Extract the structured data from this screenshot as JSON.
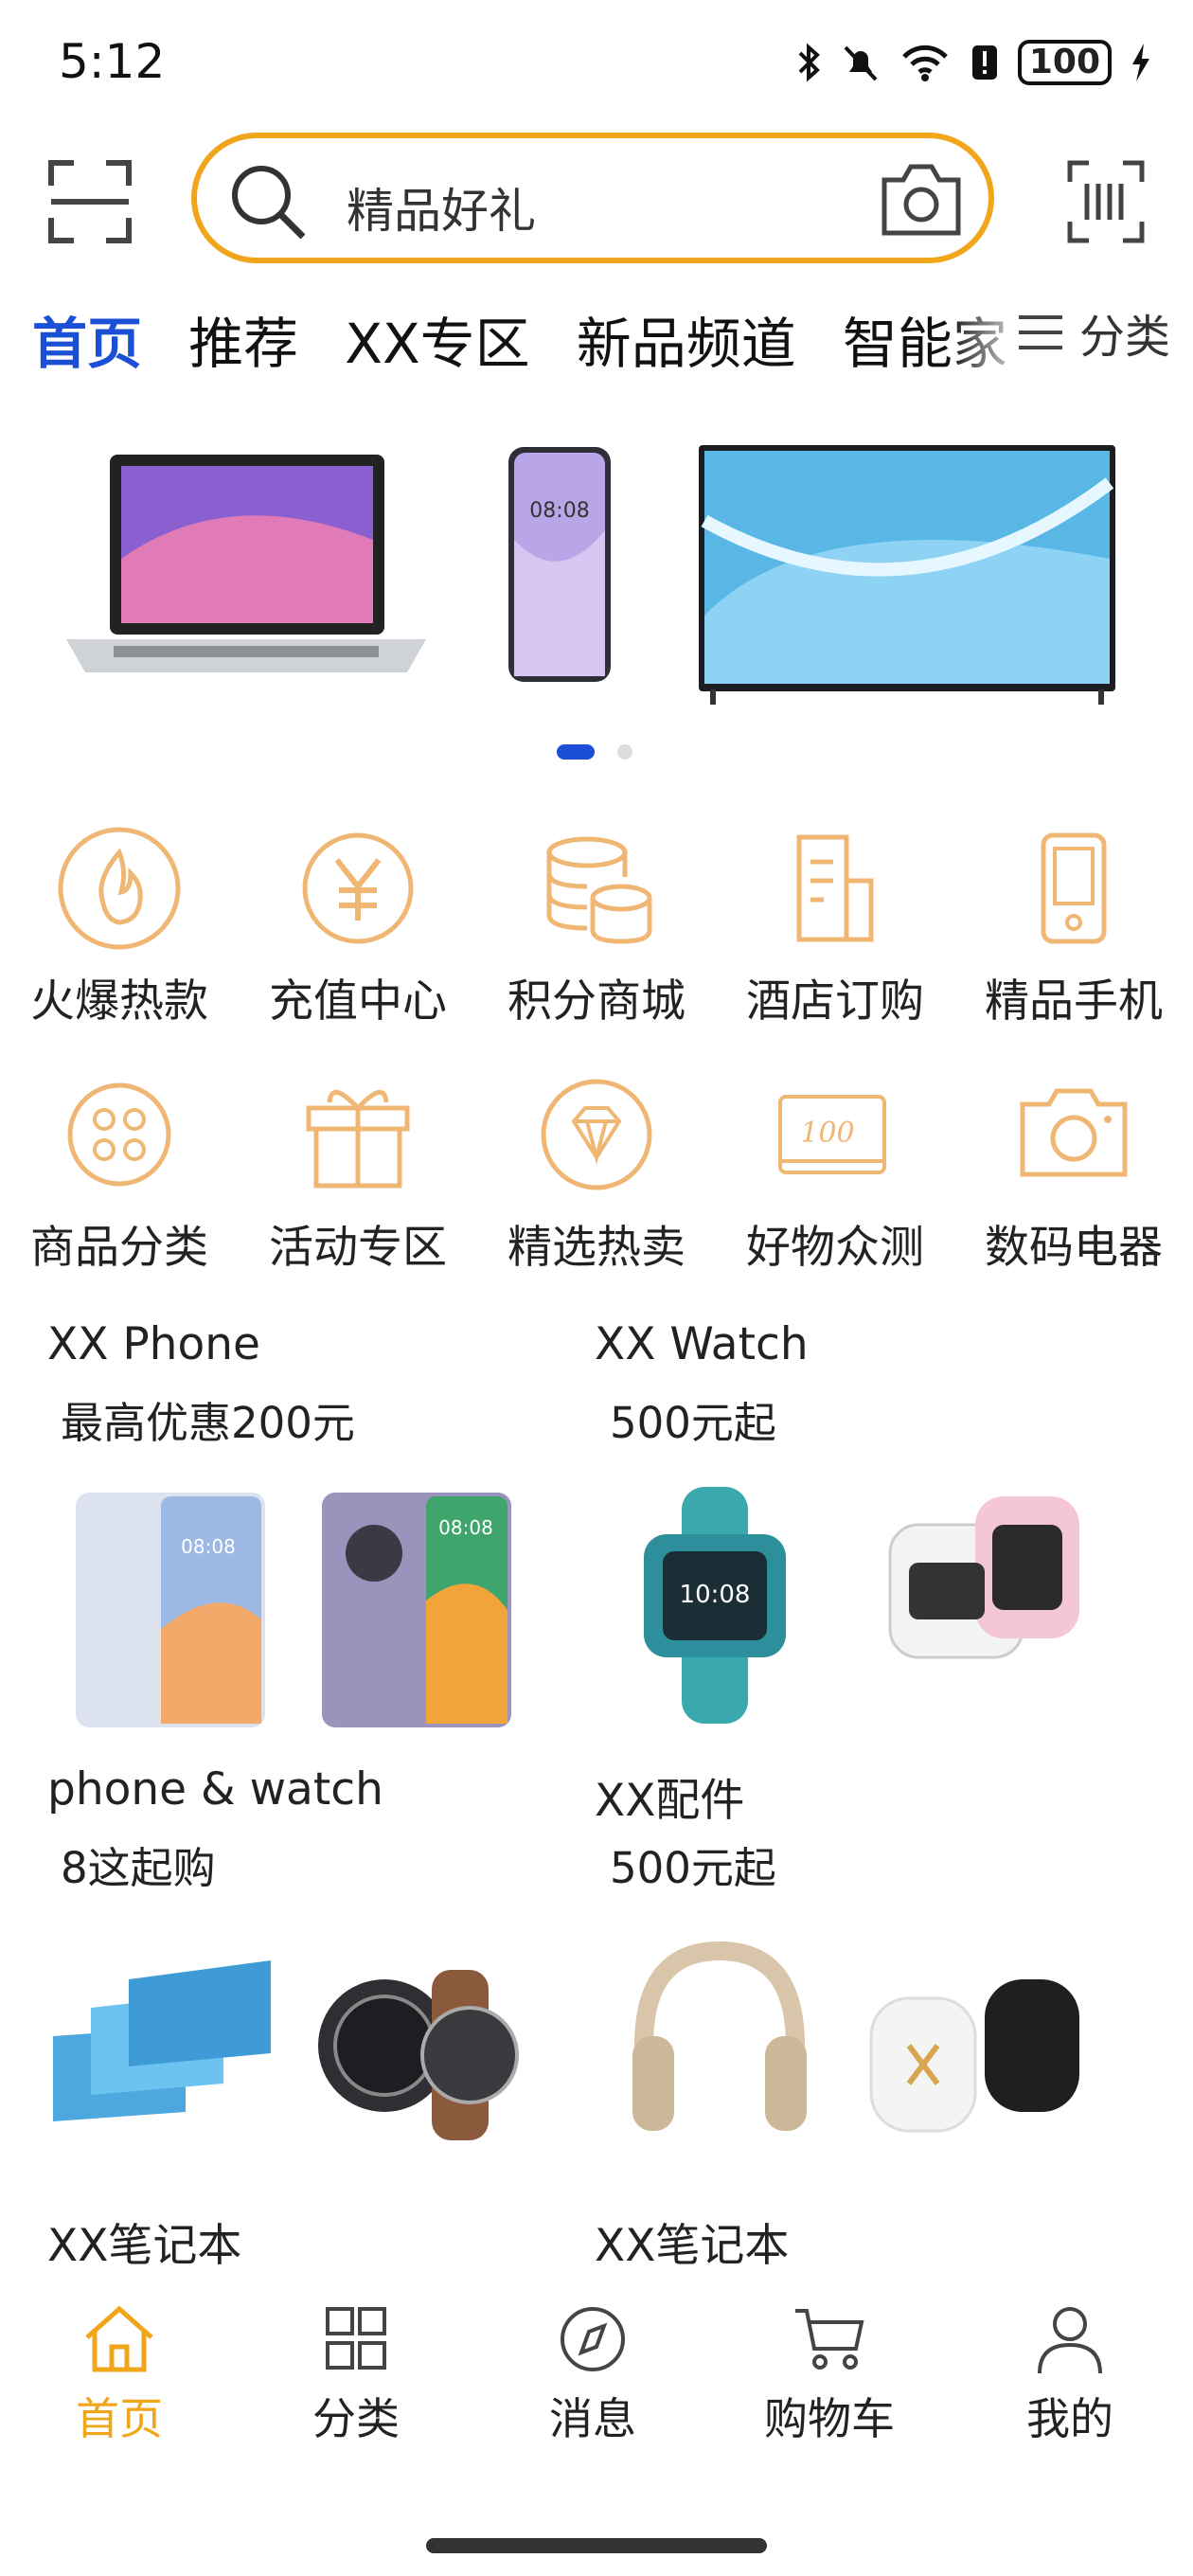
{
  "status_bar": {
    "time": "5:12",
    "battery": "100"
  },
  "search": {
    "placeholder": "精品好礼"
  },
  "tabs": [
    {
      "label": "首页",
      "active": true
    },
    {
      "label": "推荐"
    },
    {
      "label": "XX专区"
    },
    {
      "label": "新品频道"
    },
    {
      "label": "智能家"
    }
  ],
  "category_button": "分类",
  "quick_links": [
    {
      "label": "火爆热款",
      "icon": "flame-icon"
    },
    {
      "label": "充值中心",
      "icon": "yuan-icon"
    },
    {
      "label": "积分商城",
      "icon": "coins-icon"
    },
    {
      "label": "酒店订购",
      "icon": "building-icon"
    },
    {
      "label": "精品手机",
      "icon": "phone-icon"
    },
    {
      "label": "商品分类",
      "icon": "dots-grid-icon"
    },
    {
      "label": "活动专区",
      "icon": "gift-icon"
    },
    {
      "label": "精选热卖",
      "icon": "diamond-icon"
    },
    {
      "label": "好物众测",
      "icon": "coupon-icon"
    },
    {
      "label": "数码电器",
      "icon": "camera-icon"
    }
  ],
  "products": [
    {
      "title": "XX Phone",
      "subtitle": "最高优惠200元"
    },
    {
      "title": "XX Watch",
      "subtitle": "500元起"
    },
    {
      "title": "phone & watch",
      "subtitle": "8这起购"
    },
    {
      "title": "XX配件",
      "subtitle": "500元起"
    },
    {
      "title": "XX笔记本",
      "subtitle": ""
    },
    {
      "title": "XX笔记本",
      "subtitle": ""
    }
  ],
  "bottom_nav": [
    {
      "label": "首页",
      "active": true
    },
    {
      "label": "分类"
    },
    {
      "label": "消息"
    },
    {
      "label": "购物车"
    },
    {
      "label": "我的"
    }
  ],
  "colors": {
    "accent": "#f0a51a",
    "active_tab": "#1a4fd6"
  }
}
